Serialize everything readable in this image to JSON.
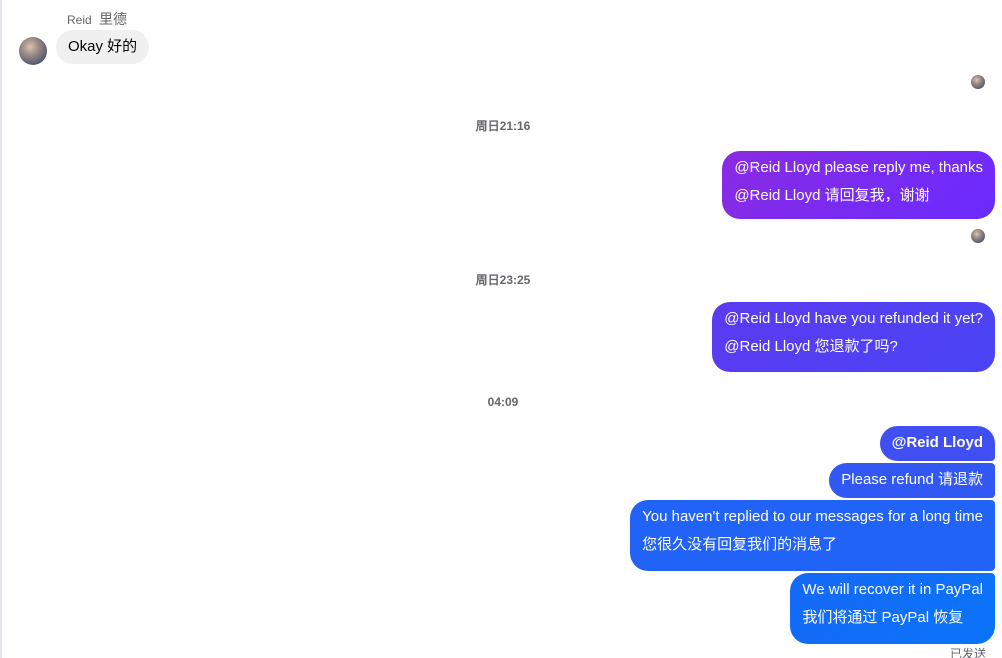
{
  "incoming": {
    "sender_name": "Reid",
    "sender_name_cn": "里德",
    "message": "Okay  好的"
  },
  "timestamps": [
    "周日21:16",
    "周日23:25",
    "04:09"
  ],
  "outgoing": [
    {
      "lines": [
        "@Reid Lloyd please reply me, thanks",
        "@Reid Lloyd 请回复我，谢谢"
      ]
    },
    {
      "lines": [
        "@Reid Lloyd have you refunded it yet?",
        "@Reid Lloyd 您退款了吗?"
      ]
    },
    {
      "lines": [
        "@Reid Lloyd"
      ]
    },
    {
      "lines": [
        "Please refund  请退款"
      ]
    },
    {
      "lines": [
        "You haven't replied to our messages for a long time",
        "您很久没有回复我们的消息了"
      ]
    },
    {
      "lines": [
        "We will recover it in PayPal",
        "我们将通过 PayPal 恢复"
      ]
    }
  ],
  "status_text": "已发送",
  "icons": {
    "avatar": "user-avatar",
    "read_receipt": "read-receipt-avatar"
  },
  "colors": {
    "incoming_bubble": "#f0f0f0",
    "outgoing_purple": "#7b2cf0",
    "outgoing_blue": "#0a74f9",
    "meta_text": "#65676b"
  }
}
